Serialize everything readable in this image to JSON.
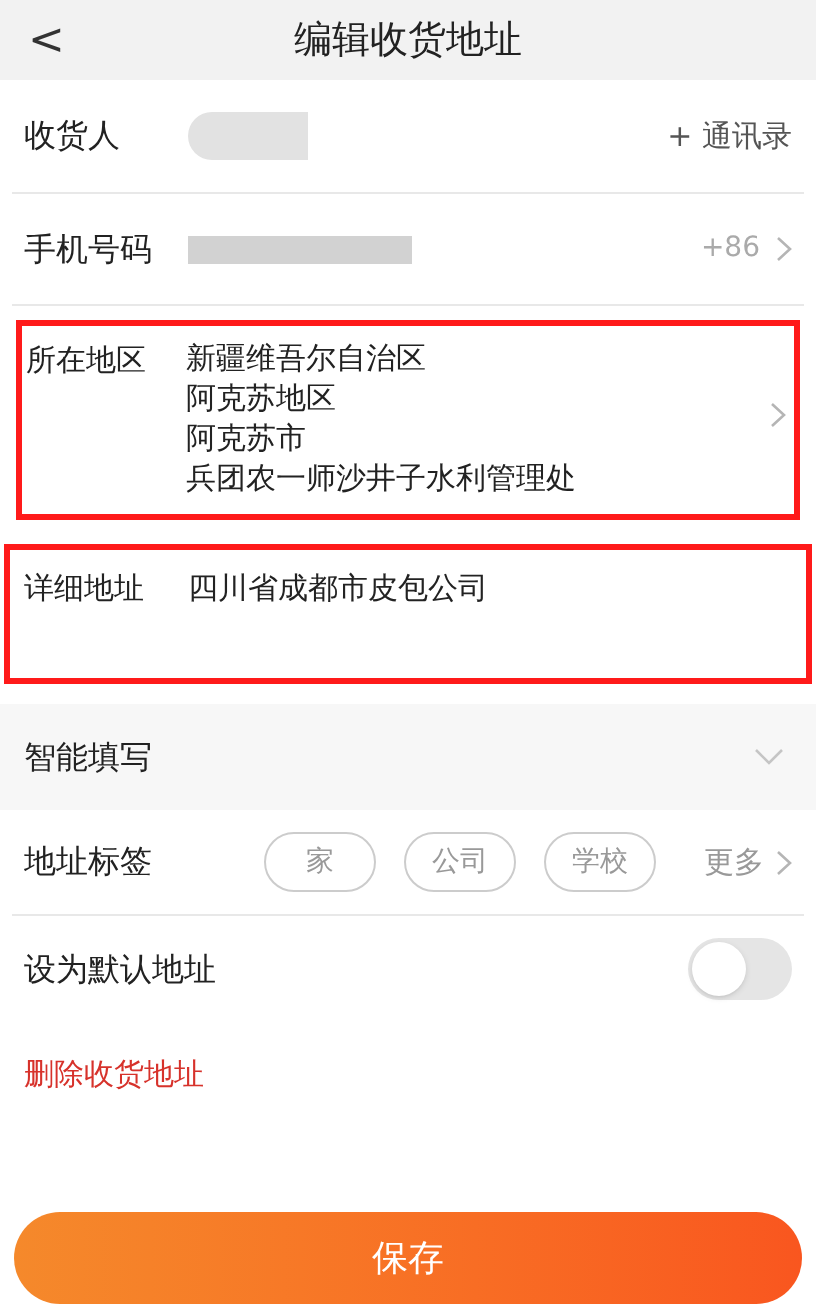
{
  "header": {
    "back": "<",
    "title": "编辑收货地址"
  },
  "consignee": {
    "label": "收货人",
    "contacts": "+ 通讯录"
  },
  "phone": {
    "label": "手机号码",
    "code": "+86"
  },
  "region": {
    "label": "所在地区",
    "lines": [
      "新疆维吾尔自治区",
      "阿克苏地区",
      "阿克苏市",
      "兵团农一师沙井子水利管理处"
    ],
    "highlighted": true
  },
  "detail": {
    "label": "详细地址",
    "value": "四川省成都市皮包公司",
    "highlighted": true
  },
  "smart_fill": {
    "label": "智能填写",
    "expanded": false
  },
  "tags": {
    "label": "地址标签",
    "items": [
      {
        "label": "家",
        "selected": false
      },
      {
        "label": "公司",
        "selected": false
      },
      {
        "label": "学校",
        "selected": false
      }
    ],
    "more": "更多"
  },
  "default_address": {
    "label": "设为默认地址",
    "on": false
  },
  "delete": "删除收货地址",
  "save": "保存"
}
